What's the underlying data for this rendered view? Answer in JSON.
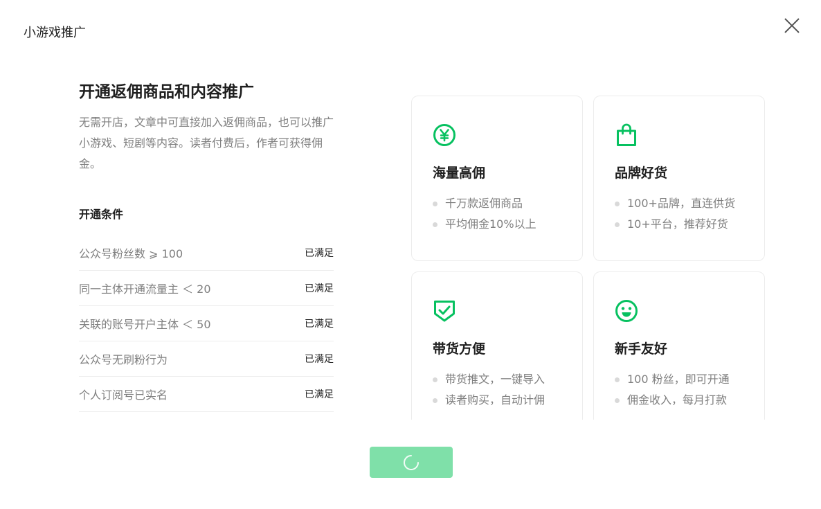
{
  "dialog": {
    "title": "小游戏推广"
  },
  "intro": {
    "headline": "开通返佣商品和内容推广",
    "description": "无需开店，文章中可直接加入返佣商品，也可以推广小游戏、短剧等内容。读者付费后，作者可获得佣金。"
  },
  "conditions": {
    "title": "开通条件",
    "items": [
      {
        "label": "公众号粉丝数 ⩾ 100",
        "status": "已满足"
      },
      {
        "label": "同一主体开通流量主 ＜ 20",
        "status": "已满足"
      },
      {
        "label": "关联的账号开户主体 ＜ 50",
        "status": "已满足"
      },
      {
        "label": "公众号无刷粉行为",
        "status": "已满足"
      },
      {
        "label": "个人订阅号已实名",
        "status": "已满足"
      }
    ]
  },
  "features": [
    {
      "icon": "yuan-coin-icon",
      "title": "海量高佣",
      "points": [
        "千万款返佣商品",
        "平均佣金10%以上"
      ]
    },
    {
      "icon": "shopping-bag-icon",
      "title": "品牌好货",
      "points": [
        "100+品牌，直连供货",
        "10+平台，推荐好货"
      ]
    },
    {
      "icon": "shield-check-icon",
      "title": "带货方便",
      "points": [
        "带货推文，一键导入",
        "读者购买，自动计佣"
      ]
    },
    {
      "icon": "smiley-face-icon",
      "title": "新手友好",
      "points": [
        "100 粉丝，即可开通",
        "佣金收入，每月打款"
      ]
    }
  ],
  "colors": {
    "accent": "#07c160",
    "button_loading": "#7fe0a9",
    "text_primary": "#1f1f1f",
    "text_secondary": "#7f7f7f"
  },
  "submit": {
    "state": "loading"
  }
}
